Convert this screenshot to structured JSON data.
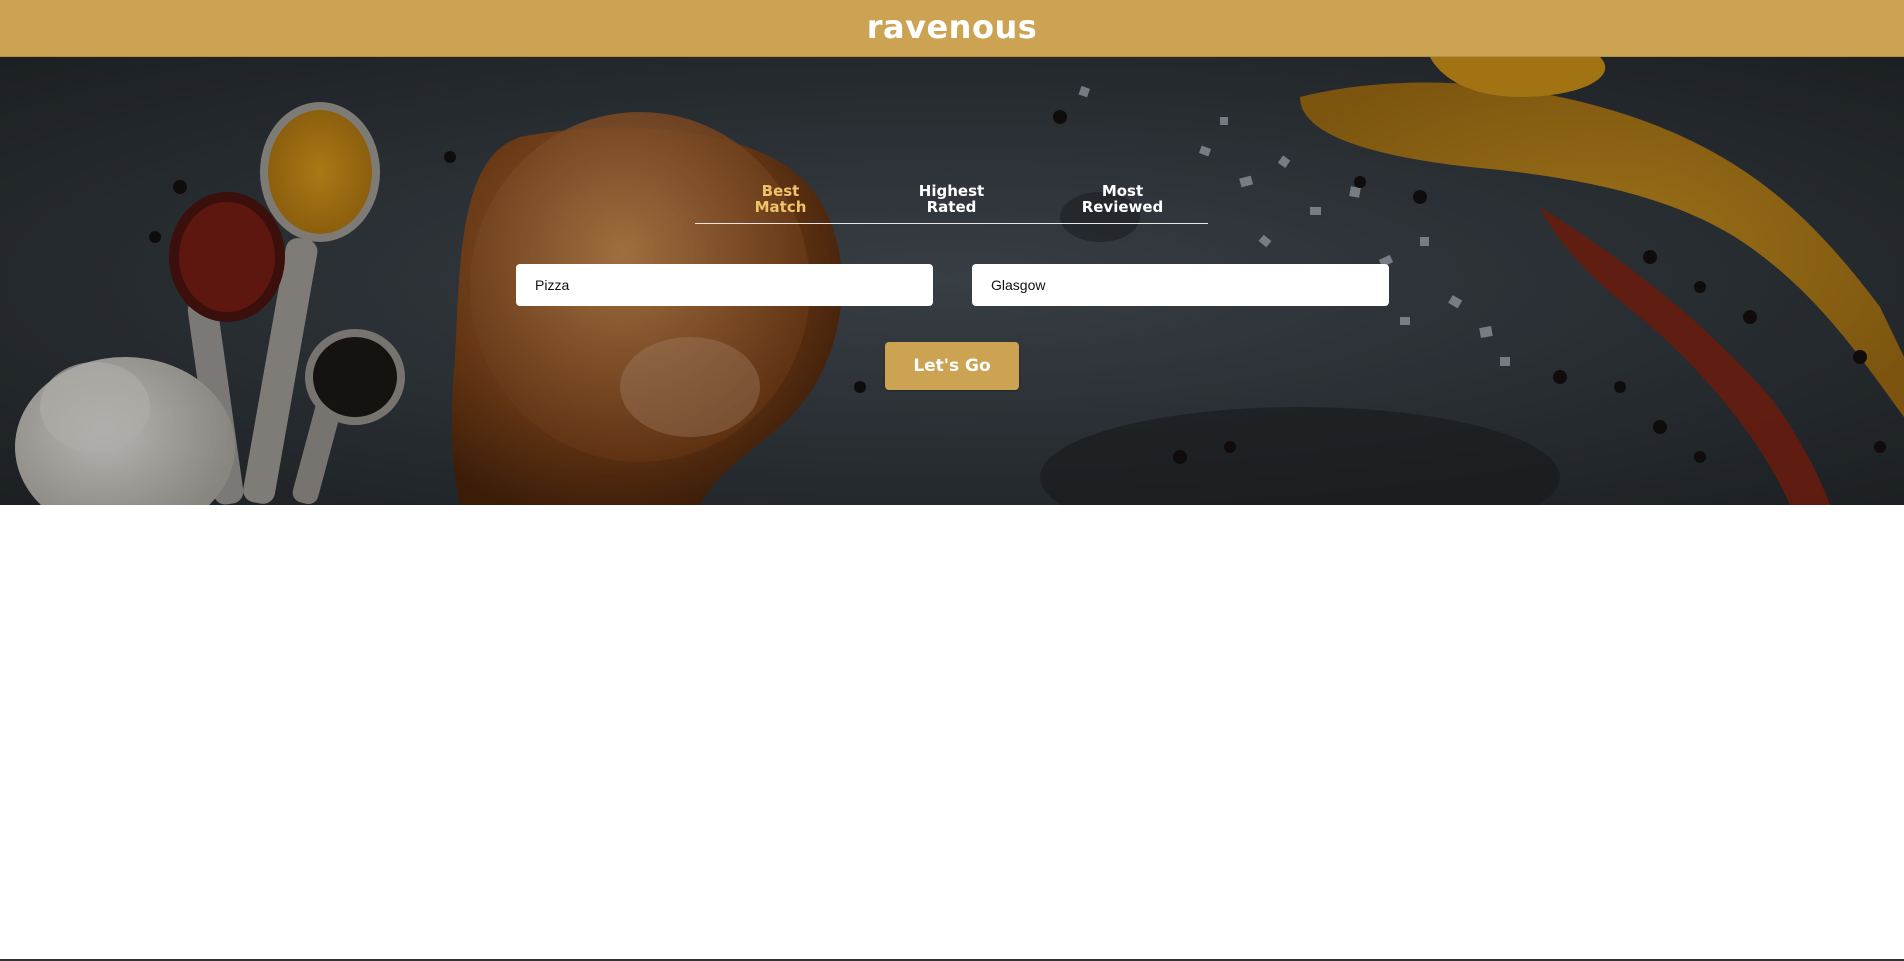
{
  "app": {
    "brand": "ravenous"
  },
  "search": {
    "sort_options": [
      {
        "label": "Best\nMatch",
        "active": true
      },
      {
        "label": "Highest\nRated",
        "active": false
      },
      {
        "label": "Most\nReviewed",
        "active": false
      }
    ],
    "terms_value": "Pizza",
    "location_value": "Glasgow",
    "submit_label": "Let's Go"
  },
  "colors": {
    "brand_gold": "#cca353",
    "active_tab": "#f0c36b"
  },
  "hero": {
    "image_description_icon": "spices-background"
  }
}
